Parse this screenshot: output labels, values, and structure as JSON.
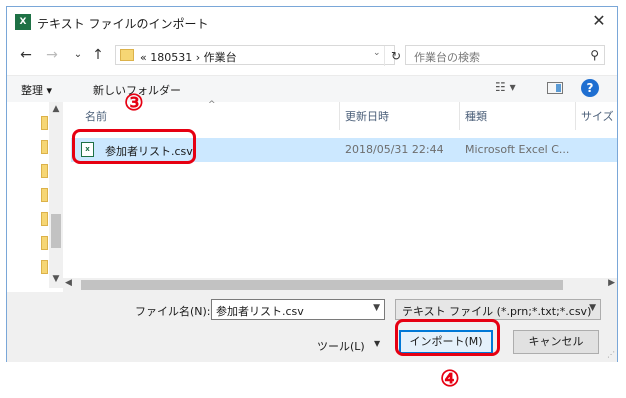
{
  "window": {
    "title": "テキスト ファイルのインポート",
    "app_icon": "excel-icon",
    "close": "✕"
  },
  "nav": {
    "back": "←",
    "forward": "→",
    "history": "⌄",
    "up": "↑"
  },
  "address": {
    "path": "«  180531  ›  作業台",
    "refresh": "↻"
  },
  "search": {
    "placeholder": "作業台の検索",
    "icon": "🔍"
  },
  "toolbar": {
    "organize": "整理 ▾",
    "new_folder": "新しいフォルダー",
    "help": "?"
  },
  "columns": {
    "name": "名前",
    "modified": "更新日時",
    "type": "種類",
    "size": "サイズ"
  },
  "files": [
    {
      "name": "参加者リスト.csv",
      "modified": "2018/05/31 22:44",
      "type": "Microsoft Excel C...",
      "icon": "csv-file-icon"
    }
  ],
  "bottom": {
    "filename_label": "ファイル名(N):",
    "filename_value": "参加者リスト.csv",
    "filetype_value": "テキスト ファイル (*.prn;*.txt;*.csv)",
    "tools_label": "ツール(L)",
    "import_label": "インポート(M)",
    "cancel_label": "キャンセル"
  },
  "annotations": {
    "step3": "③",
    "step4": "④",
    "color": "#e60012"
  },
  "colors": {
    "selection": "#cce8ff",
    "accent": "#0078d7",
    "excel_green": "#1e7145"
  }
}
